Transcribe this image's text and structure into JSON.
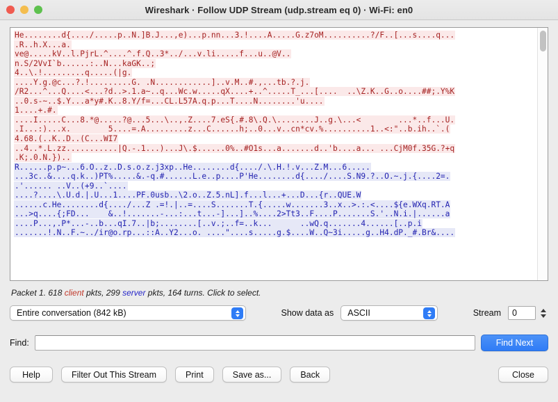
{
  "window": {
    "title": "Wireshark · Follow UDP Stream (udp.stream eq 0) · Wi-Fi: en0",
    "traffic_lights": {
      "close": "close-button",
      "minimize": "minimize-button",
      "maximize": "maximize-button"
    }
  },
  "stream": {
    "lines": [
      {
        "peer": "client",
        "text": "He........d{..../.....p..N.]B.J...,e)...p.nn...3.!....A.....G.z7oM..........?/F..[...s....q..."
      },
      {
        "peer": "client",
        "text": ".R..h.X...a."
      },
      {
        "peer": "client",
        "text": "ve@.....kV..l.PjrL.^....^.f.Q..3*../...v.li.....f...u..@V.."
      },
      {
        "peer": "client",
        "text": "n.S/2VvI`b......:..N...kaGK..;"
      },
      {
        "peer": "client",
        "text": "4..\\.!.........q.....(|g."
      },
      {
        "peer": "client",
        "text": "....Y.g.@c...?.!.........G. .N............]..v.M..#.,...tb.?.j."
      },
      {
        "peer": "client",
        "text": "/R2...^...Q....<...?d..>.1.a~..q...Wc.w.....qX....+..^.....T_...[....  ..\\Z.K..G..o....##;.Y%K"
      },
      {
        "peer": "client",
        "text": "..0.s-~..$.Y...a*y#.K..8.Y/f=...CL.L57A.q.p...T....N........'u...."
      },
      {
        "peer": "client",
        "text": "1....+.#."
      },
      {
        "peer": "client",
        "text": "....I.....C...8.*@.....?@...5...\\..,.Z....7.eS{.#.8\\.Q.\\........J..g.\\...<        ...*..f...U."
      },
      {
        "peer": "client",
        "text": ".I...:)...x.        5....=.A.........z...C......h;..0...v..cn*cv.%..........1..<:\"..b.ih..`.("
      },
      {
        "peer": "client",
        "text": "4.68.(..K..D..(C...WI7"
      },
      {
        "peer": "client",
        "text": "..4..*.L.zz...........|Q.-.1...)...J\\.$......0%..#O1s...a.......d..'b....a... ...CjM0f.35G.?+q"
      },
      {
        "peer": "client",
        "text": ".K;.0.N.}).."
      },
      {
        "peer": "server",
        "text": "R......p.p~...6.O..z..D.s.o.z.j3xp..He........d{..../.\\.H.!.v...Z.M...6....."
      },
      {
        "peer": "server",
        "text": "...3c..&....q.k..)PT%.....&.-q.#......L.e..p....P'He........d{..../....S.N9.?..O.~.j.{....2=."
      },
      {
        "peer": "server",
        "text": ".'...... ..V..(+9..`...."
      },
      {
        "peer": "server",
        "text": "....?....\\.U.d.|.U...1....PF.0usb..\\2.o..Z.5.nL].f...l...+...D...{r..QUE.W"
      },
      {
        "peer": "server",
        "text": "......c.He........d{..../...Z .=!.|..=....S.......T.{.....w.......3..x..>.:.<....${e.WXq.RT.A"
      },
      {
        "peer": "server",
        "text": "...>q....{;FD...    &..!.......-...:...t...-]...]..%....2>Tt3..F....P.......S.'..N.i.|......a"
      },
      {
        "peer": "server",
        "text": "....P...,.P*...-..b...qI.7..|b;........[..v.;..f=..k...      ..wQ.q.......4......[..p.i"
      },
      {
        "peer": "server",
        "text": ".......!.N..F.~../ir@o.rp...::A..Y2...o. ....\"....s.....g.$....W..Q~3i.....g..H4.dP._#.Br&...."
      }
    ],
    "scrollbar": "vertical-scrollbar"
  },
  "status": {
    "prefix": "Packet 1. 618 ",
    "client_word": "client",
    "middle": " pkts, 299 ",
    "server_word": "server",
    "suffix": " pkts, 164 turns. Click to select."
  },
  "controls": {
    "conversation_value": "Entire conversation (842 kB)",
    "show_data_as_label": "Show data as",
    "show_data_as_value": "ASCII",
    "stream_label": "Stream",
    "stream_value": "0"
  },
  "find": {
    "label": "Find:",
    "value": "",
    "placeholder": "",
    "find_next_label": "Find Next"
  },
  "buttons": {
    "help": "Help",
    "filter_out": "Filter Out This Stream",
    "print": "Print",
    "save_as": "Save as...",
    "back": "Back",
    "close": "Close"
  },
  "colors": {
    "client_text": "#a52222",
    "client_bg": "#fbe9e9",
    "server_text": "#2222b0",
    "server_bg": "#e6e8f7",
    "accent": "#2f7cf6"
  }
}
